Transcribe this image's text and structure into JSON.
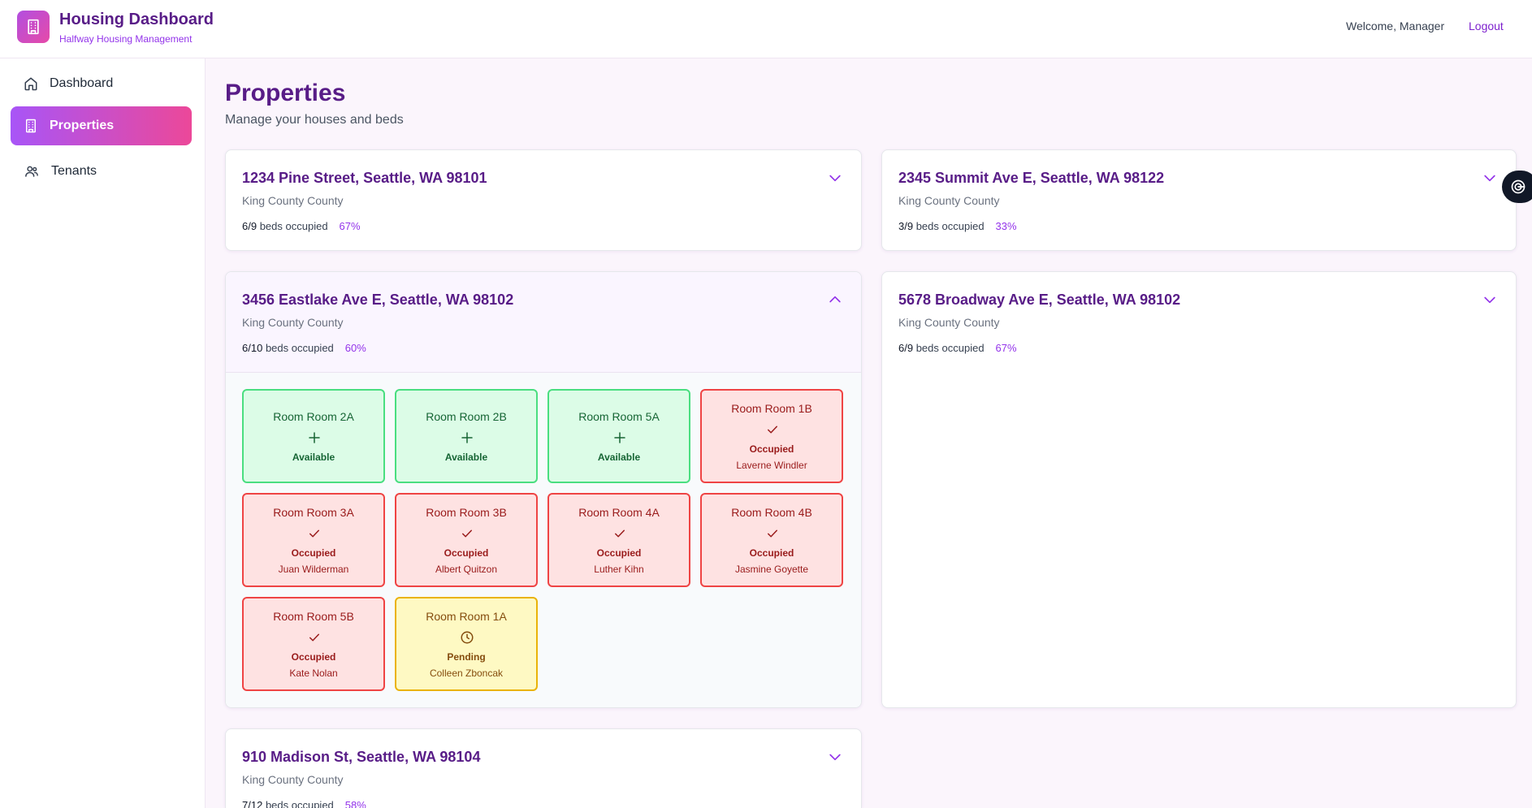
{
  "header": {
    "app_title": "Housing Dashboard",
    "app_subtitle": "Halfway Housing Management",
    "welcome": "Welcome, Manager",
    "logout_label": "Logout"
  },
  "sidebar": {
    "items": [
      {
        "label": "Dashboard",
        "icon": "home-icon",
        "active": false
      },
      {
        "label": "Properties",
        "icon": "building-icon",
        "active": true
      },
      {
        "label": "Tenants",
        "icon": "users-icon",
        "active": false
      }
    ]
  },
  "main": {
    "title": "Properties",
    "subtitle": "Manage your houses and beds"
  },
  "properties": [
    {
      "address": "1234 Pine Street, Seattle, WA 98101",
      "county": "King County County",
      "beds_count": "6/9",
      "beds_label": "beds occupied",
      "percent": "67%",
      "expanded": false
    },
    {
      "address": "2345 Summit Ave E, Seattle, WA 98122",
      "county": "King County County",
      "beds_count": "3/9",
      "beds_label": "beds occupied",
      "percent": "33%",
      "expanded": false
    },
    {
      "address": "3456 Eastlake Ave E, Seattle, WA 98102",
      "county": "King County County",
      "beds_count": "6/10",
      "beds_label": "beds occupied",
      "percent": "60%",
      "expanded": true,
      "rooms": [
        {
          "name": "Room Room 2A",
          "status": "Available",
          "tenant": "",
          "icon": "plus-icon"
        },
        {
          "name": "Room Room 2B",
          "status": "Available",
          "tenant": "",
          "icon": "plus-icon"
        },
        {
          "name": "Room Room 5A",
          "status": "Available",
          "tenant": "",
          "icon": "plus-icon"
        },
        {
          "name": "Room Room 1B",
          "status": "Occupied",
          "tenant": "Laverne Windler",
          "icon": "check-icon"
        },
        {
          "name": "Room Room 3A",
          "status": "Occupied",
          "tenant": "Juan Wilderman",
          "icon": "check-icon"
        },
        {
          "name": "Room Room 3B",
          "status": "Occupied",
          "tenant": "Albert Quitzon",
          "icon": "check-icon"
        },
        {
          "name": "Room Room 4A",
          "status": "Occupied",
          "tenant": "Luther Kihn",
          "icon": "check-icon"
        },
        {
          "name": "Room Room 4B",
          "status": "Occupied",
          "tenant": "Jasmine Goyette",
          "icon": "check-icon"
        },
        {
          "name": "Room Room 5B",
          "status": "Occupied",
          "tenant": "Kate Nolan",
          "icon": "check-icon"
        },
        {
          "name": "Room Room 1A",
          "status": "Pending",
          "tenant": "Colleen Zboncak",
          "icon": "clock-icon"
        }
      ]
    },
    {
      "address": "5678 Broadway Ave E, Seattle, WA 98102",
      "county": "King County County",
      "beds_count": "6/9",
      "beds_label": "beds occupied",
      "percent": "67%",
      "expanded": false
    },
    {
      "address": "910 Madison St, Seattle, WA 98104",
      "county": "King County County",
      "beds_count": "7/12",
      "beds_label": "beds occupied",
      "percent": "58%",
      "expanded": false
    }
  ],
  "colors": {
    "brand_purple": "#581c87",
    "accent_purple": "#9333ea",
    "gradient_start": "#a855f7",
    "gradient_end": "#ec4899",
    "available": "#4ade80",
    "occupied": "#ef4444",
    "pending": "#eab308"
  }
}
